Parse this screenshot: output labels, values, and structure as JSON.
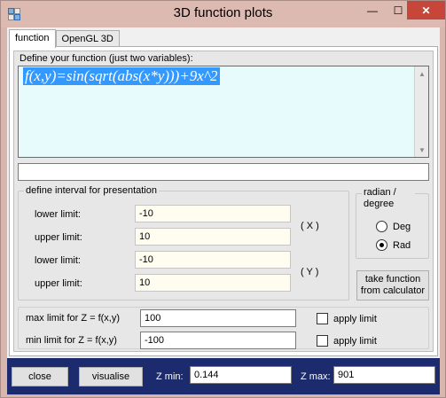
{
  "window": {
    "title": "3D function plots",
    "controls": {
      "minimize": "—",
      "maximize": "☐",
      "close": "✕"
    }
  },
  "tabs": [
    {
      "label": "function",
      "active": true
    },
    {
      "label": "OpenGL 3D",
      "active": false
    }
  ],
  "function_section": {
    "label": "Define your function (just two variables):",
    "expression": "f(x,y)=sin(sqrt(abs(x*y)))+9x^2",
    "message": ""
  },
  "interval": {
    "group_title": "define interval for presentation",
    "rows": [
      {
        "label": "lower limit:",
        "value": "-10"
      },
      {
        "label": "upper limit:",
        "value": "10"
      },
      {
        "label": "lower limit:",
        "value": "-10"
      },
      {
        "label": "upper limit:",
        "value": "10"
      }
    ],
    "axis_x": "( X )",
    "axis_y": "( Y )"
  },
  "angle_unit": {
    "group_title": "radian / degree",
    "options": [
      {
        "label": "Deg",
        "checked": false
      },
      {
        "label": "Rad",
        "checked": true
      }
    ]
  },
  "take_function_button": "take function from calculator",
  "z_limits": {
    "max_label": "max limit for Z = f(x,y)",
    "max_value": "100",
    "min_label": "min limit for Z = f(x,y)",
    "min_value": "-100",
    "apply_label": "apply limit"
  },
  "bottom": {
    "close_label": "close",
    "visualise_label": "visualise",
    "zmin_label": "Z min:",
    "zmin_value": "0.144",
    "zmax_label": "Z max:",
    "zmax_value": "901"
  },
  "icons": {
    "up_arrow": "▲",
    "down_arrow": "▼"
  },
  "colors": {
    "title_bar": "#dcbab2",
    "close_red": "#c7463a",
    "selection_blue": "#3399ff",
    "bottom_bar": "#1c2b6e",
    "function_bg": "#e8fbfc"
  }
}
